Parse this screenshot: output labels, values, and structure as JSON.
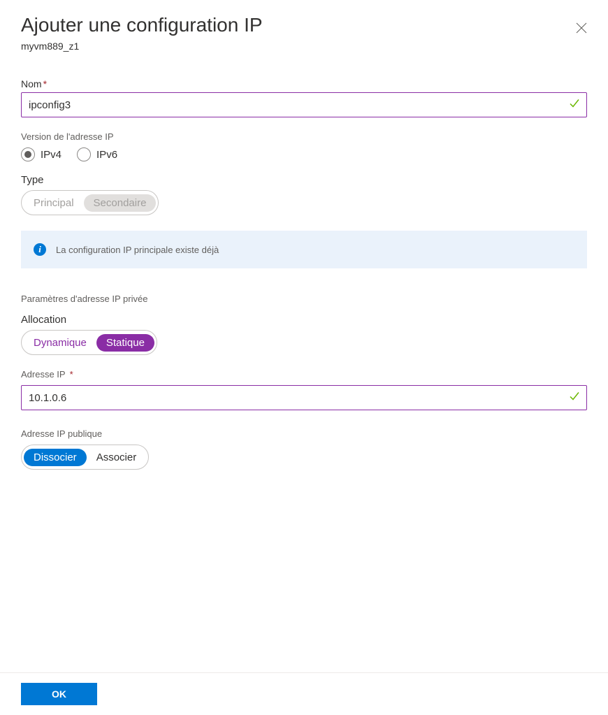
{
  "header": {
    "title": "Ajouter une configuration IP",
    "subtitle": "myvm889_z1"
  },
  "name": {
    "label": "Nom",
    "value": "ipconfig3"
  },
  "ip_version": {
    "label": "Version de l'adresse IP",
    "options": {
      "ipv4": "IPv4",
      "ipv6": "IPv6"
    },
    "selected": "ipv4"
  },
  "type": {
    "label": "Type",
    "options": {
      "principal": "Principal",
      "secondaire": "Secondaire"
    }
  },
  "info": {
    "text": "La configuration IP principale existe déjà"
  },
  "private_ip_section": {
    "heading": "Paramètres d'adresse IP privée"
  },
  "allocation": {
    "label": "Allocation",
    "options": {
      "dynamique": "Dynamique",
      "statique": "Statique"
    },
    "selected": "statique"
  },
  "ip_address": {
    "label": "Adresse IP",
    "value": "10.1.0.6"
  },
  "public_ip": {
    "label": "Adresse IP publique",
    "options": {
      "dissocier": "Dissocier",
      "associer": "Associer"
    },
    "selected": "dissocier"
  },
  "footer": {
    "ok": "OK"
  }
}
